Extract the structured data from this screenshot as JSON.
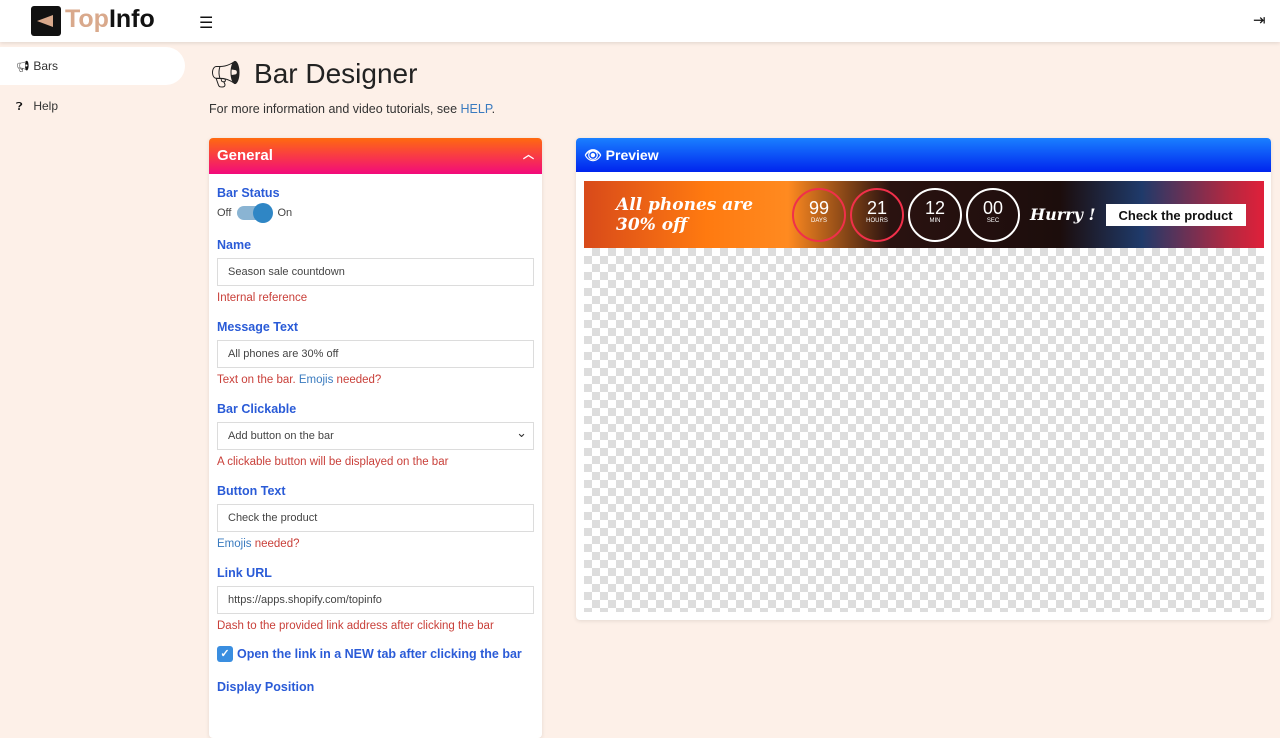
{
  "header": {
    "logo_part1": "Top",
    "logo_part2": "Info",
    "menu_icon": "hamburger-icon",
    "logout_icon": "sign-out-icon"
  },
  "sidebar": {
    "items": [
      {
        "label": "Bars",
        "icon": "bullhorn-icon",
        "active": true
      },
      {
        "label": "Help",
        "icon": "question-circle-icon",
        "active": false
      }
    ]
  },
  "page": {
    "title": "Bar Designer",
    "subtitle": "For more information and video tutorials, see ",
    "help_link": "HELP",
    "subtitle_end": "."
  },
  "general": {
    "title": "General",
    "bar_status": {
      "label": "Bar Status",
      "off": "Off",
      "on": "On",
      "value": true
    },
    "name": {
      "label": "Name",
      "value": "Season sale countdown",
      "help": "Internal reference"
    },
    "message": {
      "label": "Message Text",
      "value": "All phones are 30% off",
      "help": "Text on the bar. ",
      "help_link": "Emojis",
      "help_end": " needed?"
    },
    "clickable": {
      "label": "Bar Clickable",
      "value": "Add button on the bar",
      "help": "A clickable button will be displayed on the bar"
    },
    "button_text": {
      "label": "Button Text",
      "value": "Check the product",
      "help_link": "Emojis",
      "help_end": " needed?"
    },
    "link_url": {
      "label": "Link URL",
      "value": "https://apps.shopify.com/topinfo",
      "help": "Dash to the provided link address after clicking the bar"
    },
    "new_tab": {
      "label": "Open the link in a NEW tab after clicking the bar",
      "checked": true
    },
    "display_position": {
      "label": "Display Position"
    }
  },
  "preview": {
    "title": "Preview",
    "message": "All phones are 30% off",
    "countdown": [
      {
        "value": "99",
        "unit": "DAYS"
      },
      {
        "value": "21",
        "unit": "HOURS"
      },
      {
        "value": "12",
        "unit": "MIN"
      },
      {
        "value": "00",
        "unit": "SEC"
      }
    ],
    "hurry": "Hurry !",
    "button": "Check the product"
  },
  "colors": {
    "general_header": "#ff6a10",
    "preview_header": "#1a80ff",
    "label": "#2a5bd7",
    "help": "#c9403a"
  }
}
